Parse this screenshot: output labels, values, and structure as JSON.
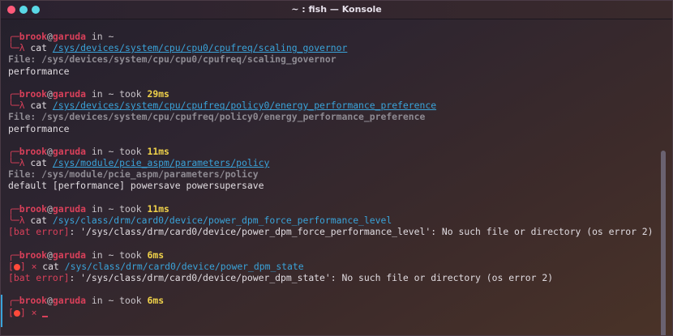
{
  "window": {
    "title": "~ : fish — Konsole"
  },
  "prompt": {
    "user": "brook",
    "at": "@",
    "host": "garuda",
    "in": " in ",
    "dir": "~",
    "took": " took ",
    "lambda": "λ",
    "corner_top": "╭─",
    "corner_bottom": "╰─",
    "err_open": "[",
    "err_close": "]",
    "x_mark": "×"
  },
  "blocks": [
    {
      "took": "",
      "cmd_prefix": " cat ",
      "path": "/sys/devices/system/cpu/cpu0/cpufreq/scaling_governor",
      "output": [
        {
          "kind": "file",
          "text": "File: /sys/devices/system/cpu/cpu0/cpufreq/scaling_governor"
        },
        {
          "kind": "normal",
          "text": "performance"
        }
      ]
    },
    {
      "took": "29ms",
      "cmd_prefix": " cat ",
      "path": "/sys/devices/system/cpu/cpufreq/policy0/energy_performance_preference",
      "output": [
        {
          "kind": "file",
          "text": "File: /sys/devices/system/cpu/cpufreq/policy0/energy_performance_preference"
        },
        {
          "kind": "normal",
          "text": "performance"
        }
      ]
    },
    {
      "took": "11ms",
      "cmd_prefix": " cat ",
      "path": "/sys/module/pcie_aspm/parameters/policy",
      "output": [
        {
          "kind": "file",
          "text": "File: /sys/module/pcie_aspm/parameters/policy"
        },
        {
          "kind": "normal",
          "text": "default [performance] powersave powersupersave"
        }
      ]
    },
    {
      "took": "11ms",
      "cmd_prefix": " cat ",
      "path": "/sys/class/drm/card0/device/power_dpm_force_performance_level",
      "output": [
        {
          "kind": "error",
          "tag": "[bat error]",
          "text": ": '/sys/class/drm/card0/device/power_dpm_force_performance_level': No such file or directory (os error 2)"
        }
      ]
    },
    {
      "took": "6ms",
      "cmd_prefix": " cat ",
      "path": "/sys/class/drm/card0/device/power_dpm_state",
      "output": [
        {
          "kind": "error",
          "tag": "[bat error]",
          "text": ": '/sys/class/drm/card0/device/power_dpm_state': No such file or directory (os error 2)"
        }
      ]
    }
  ],
  "final": {
    "took": "6ms"
  }
}
